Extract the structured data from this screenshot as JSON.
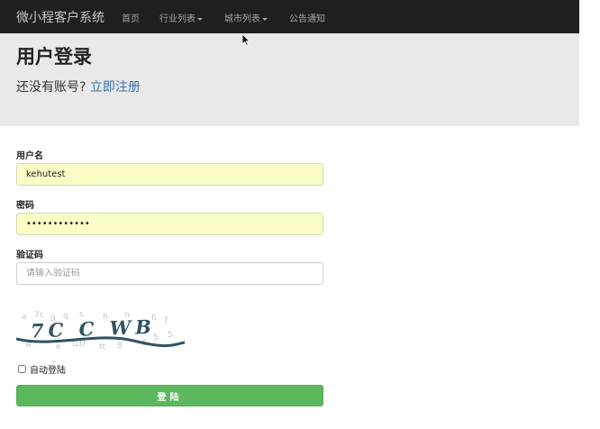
{
  "navbar": {
    "brand": "微小程客户系统",
    "items": [
      {
        "label": "首页",
        "dropdown": false
      },
      {
        "label": "行业列表",
        "dropdown": true
      },
      {
        "label": "城市列表",
        "dropdown": true
      },
      {
        "label": "公告通知",
        "dropdown": false
      }
    ]
  },
  "header": {
    "title": "用户登录",
    "subtitle_prefix": "还没有账号?",
    "register_link": "立即注册"
  },
  "form": {
    "username_label": "用户名",
    "username_value": "kehutest",
    "password_label": "密码",
    "password_value": "••••••••••••",
    "captcha_label": "验证码",
    "captcha_placeholder": "请输入验证码",
    "captcha_text": "7C C WB",
    "remember_label": "自动登陆",
    "submit_label": "登陆"
  },
  "colors": {
    "navbar_bg": "#1f1f1f",
    "jumbotron_bg": "#e9e9e9",
    "autofill_bg": "#fbfdc6",
    "submit_bg": "#5cb85c",
    "link": "#3a6fb0"
  }
}
